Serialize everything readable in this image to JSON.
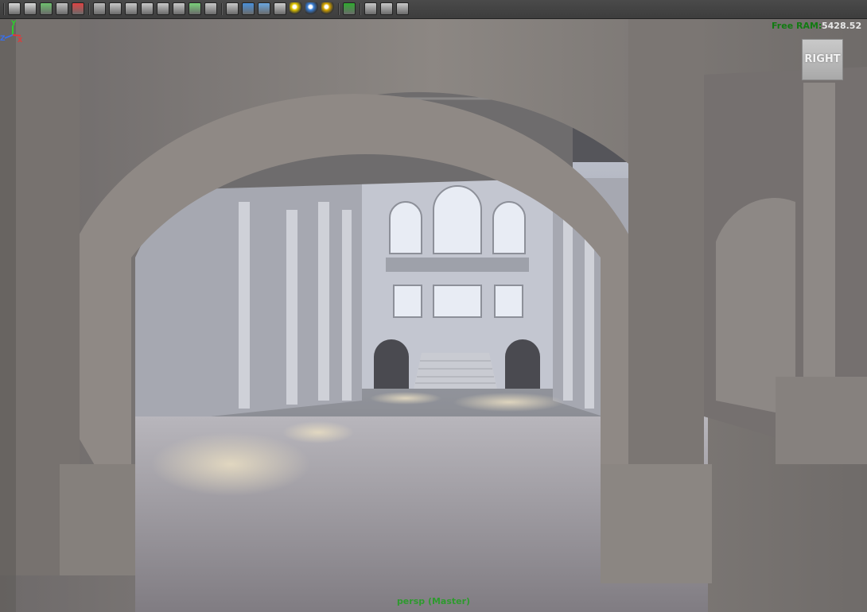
{
  "toolbar": {
    "icons": [
      {
        "name": "camera-attributes-icon",
        "color": "#d8d8d8"
      },
      {
        "name": "camera-tools-icon",
        "color": "#d8d8d8"
      },
      {
        "name": "image-plane-icon",
        "color": "#6ec06e"
      },
      {
        "name": "bookmarks-icon",
        "color": "#c0c0c0"
      },
      {
        "name": "2d-pan-zoom-icon",
        "color": "#d44"
      },
      {
        "name": "grease-pencil-icon",
        "color": "#bbbbbb"
      },
      {
        "name": "grid-icon",
        "color": "#c8c8c8"
      },
      {
        "name": "film-gate-icon",
        "color": "#c8c8c8"
      },
      {
        "name": "resolution-gate-icon",
        "color": "#c8c8c8"
      },
      {
        "name": "gate-mask-icon",
        "color": "#c8c8c8"
      },
      {
        "name": "field-chart-icon",
        "color": "#c8c8c8"
      },
      {
        "name": "safe-action-icon",
        "color": "#7ad07a"
      },
      {
        "name": "safe-title-icon",
        "color": "#c8c8c8"
      },
      {
        "name": "wireframe-icon",
        "color": "#c8c8c8"
      },
      {
        "name": "smooth-shade-icon",
        "color": "#4a90d9"
      },
      {
        "name": "wireframe-on-shaded-icon",
        "color": "#6aa7e0"
      },
      {
        "name": "textured-icon",
        "color": "#cccccc"
      },
      {
        "name": "default-lighting-icon",
        "color": "#e2c600"
      },
      {
        "name": "all-lights-icon",
        "color": "#3a7fd5"
      },
      {
        "name": "shadows-icon",
        "color": "#d9a700"
      },
      {
        "name": "isolate-select-icon",
        "color": "#2faa2f"
      },
      {
        "name": "xray-icon",
        "color": "#c8c8c8"
      },
      {
        "name": "xray-joints-icon",
        "color": "#c8c8c8"
      },
      {
        "name": "xray-components-icon",
        "color": "#c8c8c8"
      }
    ]
  },
  "hud": {
    "free_ram_label": "Free RAM:",
    "free_ram_value": "5428.52"
  },
  "viewcube": {
    "face": "RIGHT"
  },
  "axis": {
    "y_label": "Y",
    "z_label": "Z",
    "x_label": "X"
  },
  "camera": {
    "label": "persp (Master)"
  }
}
